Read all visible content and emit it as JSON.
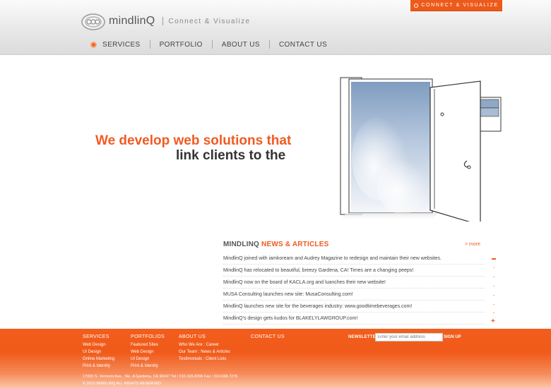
{
  "header": {
    "badge": "CONNECT & VISUALIZE",
    "logo_text": "mindlinQ",
    "tagline": "Connect & Visualize",
    "nav": [
      "SERVICES",
      "PORTFOLIO",
      "ABOUT US",
      "CONTACT US"
    ]
  },
  "hero": {
    "line1": "We develop web solutions that",
    "line2": "link clients to the"
  },
  "news": {
    "title_prefix": "MINDLINQ",
    "title_accent": "NEWS & ARTICLES",
    "more": "> more",
    "items": [
      "MindlinQ joined with iamkoream and Audrey Magazine to redesign and maintain their new websites.",
      "MindlinQ has relocated to beautiful, breezy Gardena, CA! Times are a changing peeps!",
      "MindlinQ now on the board of KACLA.org and luanches their new website!",
      "MUSA Consulting launches new site: MusaConsulting.com!",
      "MindlinQ launches new site for the beverages industry: www.goodtimebeverages.com!",
      "MindlinQ's design gets kudos for BLAKELYLAWGROUP.com!"
    ]
  },
  "footer": {
    "services": {
      "head": "SERVICES",
      "links": [
        "Web Design",
        "UI Design",
        "Online Marketing",
        "Print & Identity"
      ]
    },
    "portfolios": {
      "head": "PORTFOLIOS",
      "links": [
        "Featured Sites",
        "Web Design",
        "UI Design",
        "Print & Identity"
      ]
    },
    "about": {
      "head": "ABOUT US",
      "links": [
        "Who We Are : Career",
        "Our Team : News & Articles",
        "Testimonials : Client Lists"
      ]
    },
    "contact": {
      "head": "CONTACT US"
    },
    "newsletter": {
      "label": "NEWSLETTER",
      "placeholder": "Enter your email address",
      "button": "SIGN UP"
    },
    "address": "17000 S. Vermont Ave., Ste. A Gardena, CA 90247 Tel / 310.326.8296 Fax / 310.668.7276",
    "copyright": "© 2010 MINDLINQ ALL RIGHTS RESERVED"
  },
  "colors": {
    "accent": "#f15a22",
    "text": "#333333"
  }
}
